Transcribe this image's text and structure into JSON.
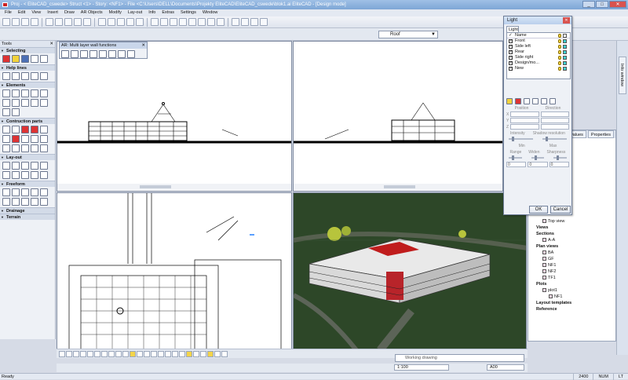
{
  "window": {
    "title": "Proj - < EliteCAD_cswede> Struct <1> - Story: <NF1> - File <C:\\Users\\DELL\\Documents\\Projekty EliteCAD\\EliteCAD_cswede\\blok1.ai EliteCAD - [Design mode]"
  },
  "menu": [
    "File",
    "Edit",
    "View",
    "Insert",
    "Draw",
    "AR Objects",
    "Modify",
    "Lay-out",
    "Info",
    "Extras",
    "Settings",
    "Window"
  ],
  "layer_select": {
    "value": "Roof"
  },
  "tools": {
    "title": "Tools",
    "groups": [
      "Selecting",
      "Help lines",
      "Elements",
      "Contruction parts",
      "Lay-out",
      "Freeform",
      "Drainage",
      "Terrain"
    ]
  },
  "multilayer": {
    "title": "AR: Multi layer wall functions"
  },
  "light_dialog": {
    "title": "Light",
    "tab": "Light",
    "columns": {
      "name": "Name"
    },
    "lights": [
      {
        "name": "Front",
        "checked": true
      },
      {
        "name": "Side left",
        "checked": true
      },
      {
        "name": "Rear",
        "checked": true
      },
      {
        "name": "Side right",
        "checked": true
      },
      {
        "name": "Design/mo...",
        "checked": true
      },
      {
        "name": "New",
        "checked": true
      }
    ],
    "position_label": "Position",
    "direction_label": "Direction",
    "x_label": "X",
    "y_label": "Y",
    "z_label": "Z",
    "intensity_label": "Intensity",
    "shadow_label": "Shadow resolution",
    "min_label": "Min",
    "max_label": "Max",
    "range_label": "Range",
    "widen_label": "Widen",
    "sharpness_label": "Sharpness",
    "value_zero": "0",
    "ok": "OK",
    "cancel": "Cancel"
  },
  "right_panel": {
    "tabs": [
      "values",
      "Properties"
    ],
    "tree": [
      {
        "label": "Top view",
        "bold": false,
        "indent": 2
      },
      {
        "label": "Views",
        "bold": true,
        "indent": 1
      },
      {
        "label": "Sections",
        "bold": true,
        "indent": 1
      },
      {
        "label": "A-A",
        "bold": false,
        "indent": 2
      },
      {
        "label": "Plan views",
        "bold": true,
        "indent": 1
      },
      {
        "label": "BA",
        "bold": false,
        "indent": 2
      },
      {
        "label": "GF",
        "bold": false,
        "indent": 2
      },
      {
        "label": "NF1",
        "bold": false,
        "indent": 2
      },
      {
        "label": "NF2",
        "bold": false,
        "indent": 2
      },
      {
        "label": "TF1",
        "bold": false,
        "indent": 2
      },
      {
        "label": "Plots",
        "bold": true,
        "indent": 1
      },
      {
        "label": "plot1",
        "bold": false,
        "indent": 2
      },
      {
        "label": "NF1",
        "bold": false,
        "indent": 3
      },
      {
        "label": "Layout templates",
        "bold": true,
        "indent": 1
      },
      {
        "label": "Reference",
        "bold": true,
        "indent": 1
      }
    ]
  },
  "sidebar_tab": "Info window",
  "working_drawing": "Working drawing",
  "scales": {
    "left": "1:100",
    "right": "A00"
  },
  "status": {
    "text": "Ready",
    "coord": "2400",
    "mode": "NUM",
    "ltr": "LT"
  }
}
